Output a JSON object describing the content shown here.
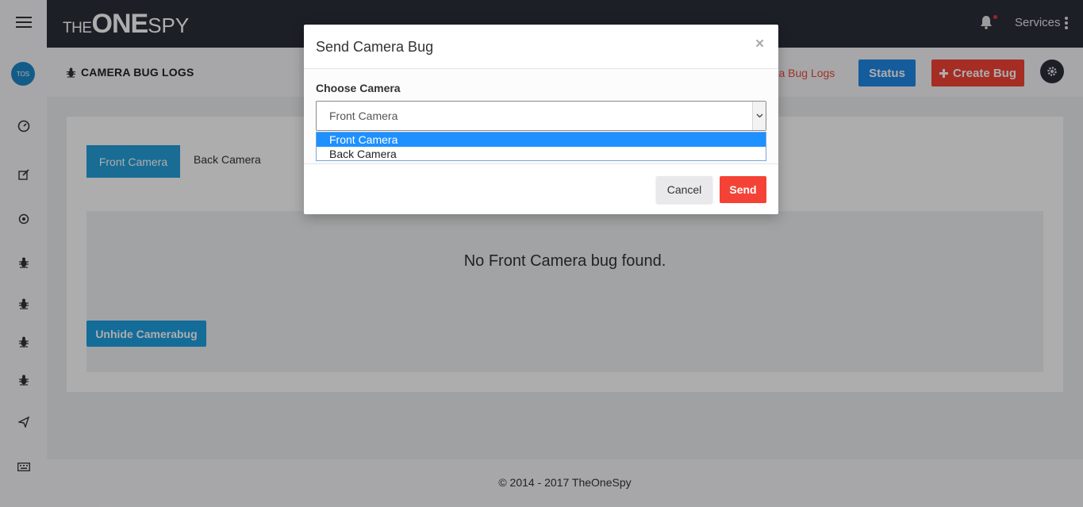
{
  "sidebar": {
    "avatar_text": "TOS",
    "items": [
      {
        "icon": "menu-icon"
      },
      {
        "icon": "dashboard-icon"
      },
      {
        "icon": "edit-icon"
      },
      {
        "icon": "target-icon"
      },
      {
        "icon": "bug-icon"
      },
      {
        "icon": "bug-icon"
      },
      {
        "icon": "bug-icon"
      },
      {
        "icon": "bug-icon"
      },
      {
        "icon": "send-icon"
      },
      {
        "icon": "keyboard-icon"
      }
    ]
  },
  "topbar": {
    "logo": {
      "the": "THE",
      "one": "ONE",
      "spy": "SPY"
    },
    "services_label": "Services"
  },
  "header": {
    "title": "CAMERA BUG LOGS",
    "breadcrumb": "era Bug Logs",
    "status_label": "Status",
    "create_label": "Create Bug"
  },
  "content": {
    "tabs": [
      {
        "label": "Front Camera",
        "active": true
      },
      {
        "label": "Back Camera",
        "active": false
      }
    ],
    "empty_message": "No Front Camera bug found.",
    "unhide_label": "Unhide Camerabug"
  },
  "footer": {
    "text": "© 2014 - 2017 TheOneSpy"
  },
  "modal": {
    "title": "Send Camera Bug",
    "close_label": "×",
    "field_label": "Choose Camera",
    "selected_value": "Front Camera",
    "options": [
      "Front Camera",
      "Back Camera"
    ],
    "cancel_label": "Cancel",
    "send_label": "Send"
  },
  "colors": {
    "topbar": "#2b2f3a",
    "primary": "#1e88e5",
    "danger": "#f44336",
    "tab_active": "#26a0da"
  }
}
